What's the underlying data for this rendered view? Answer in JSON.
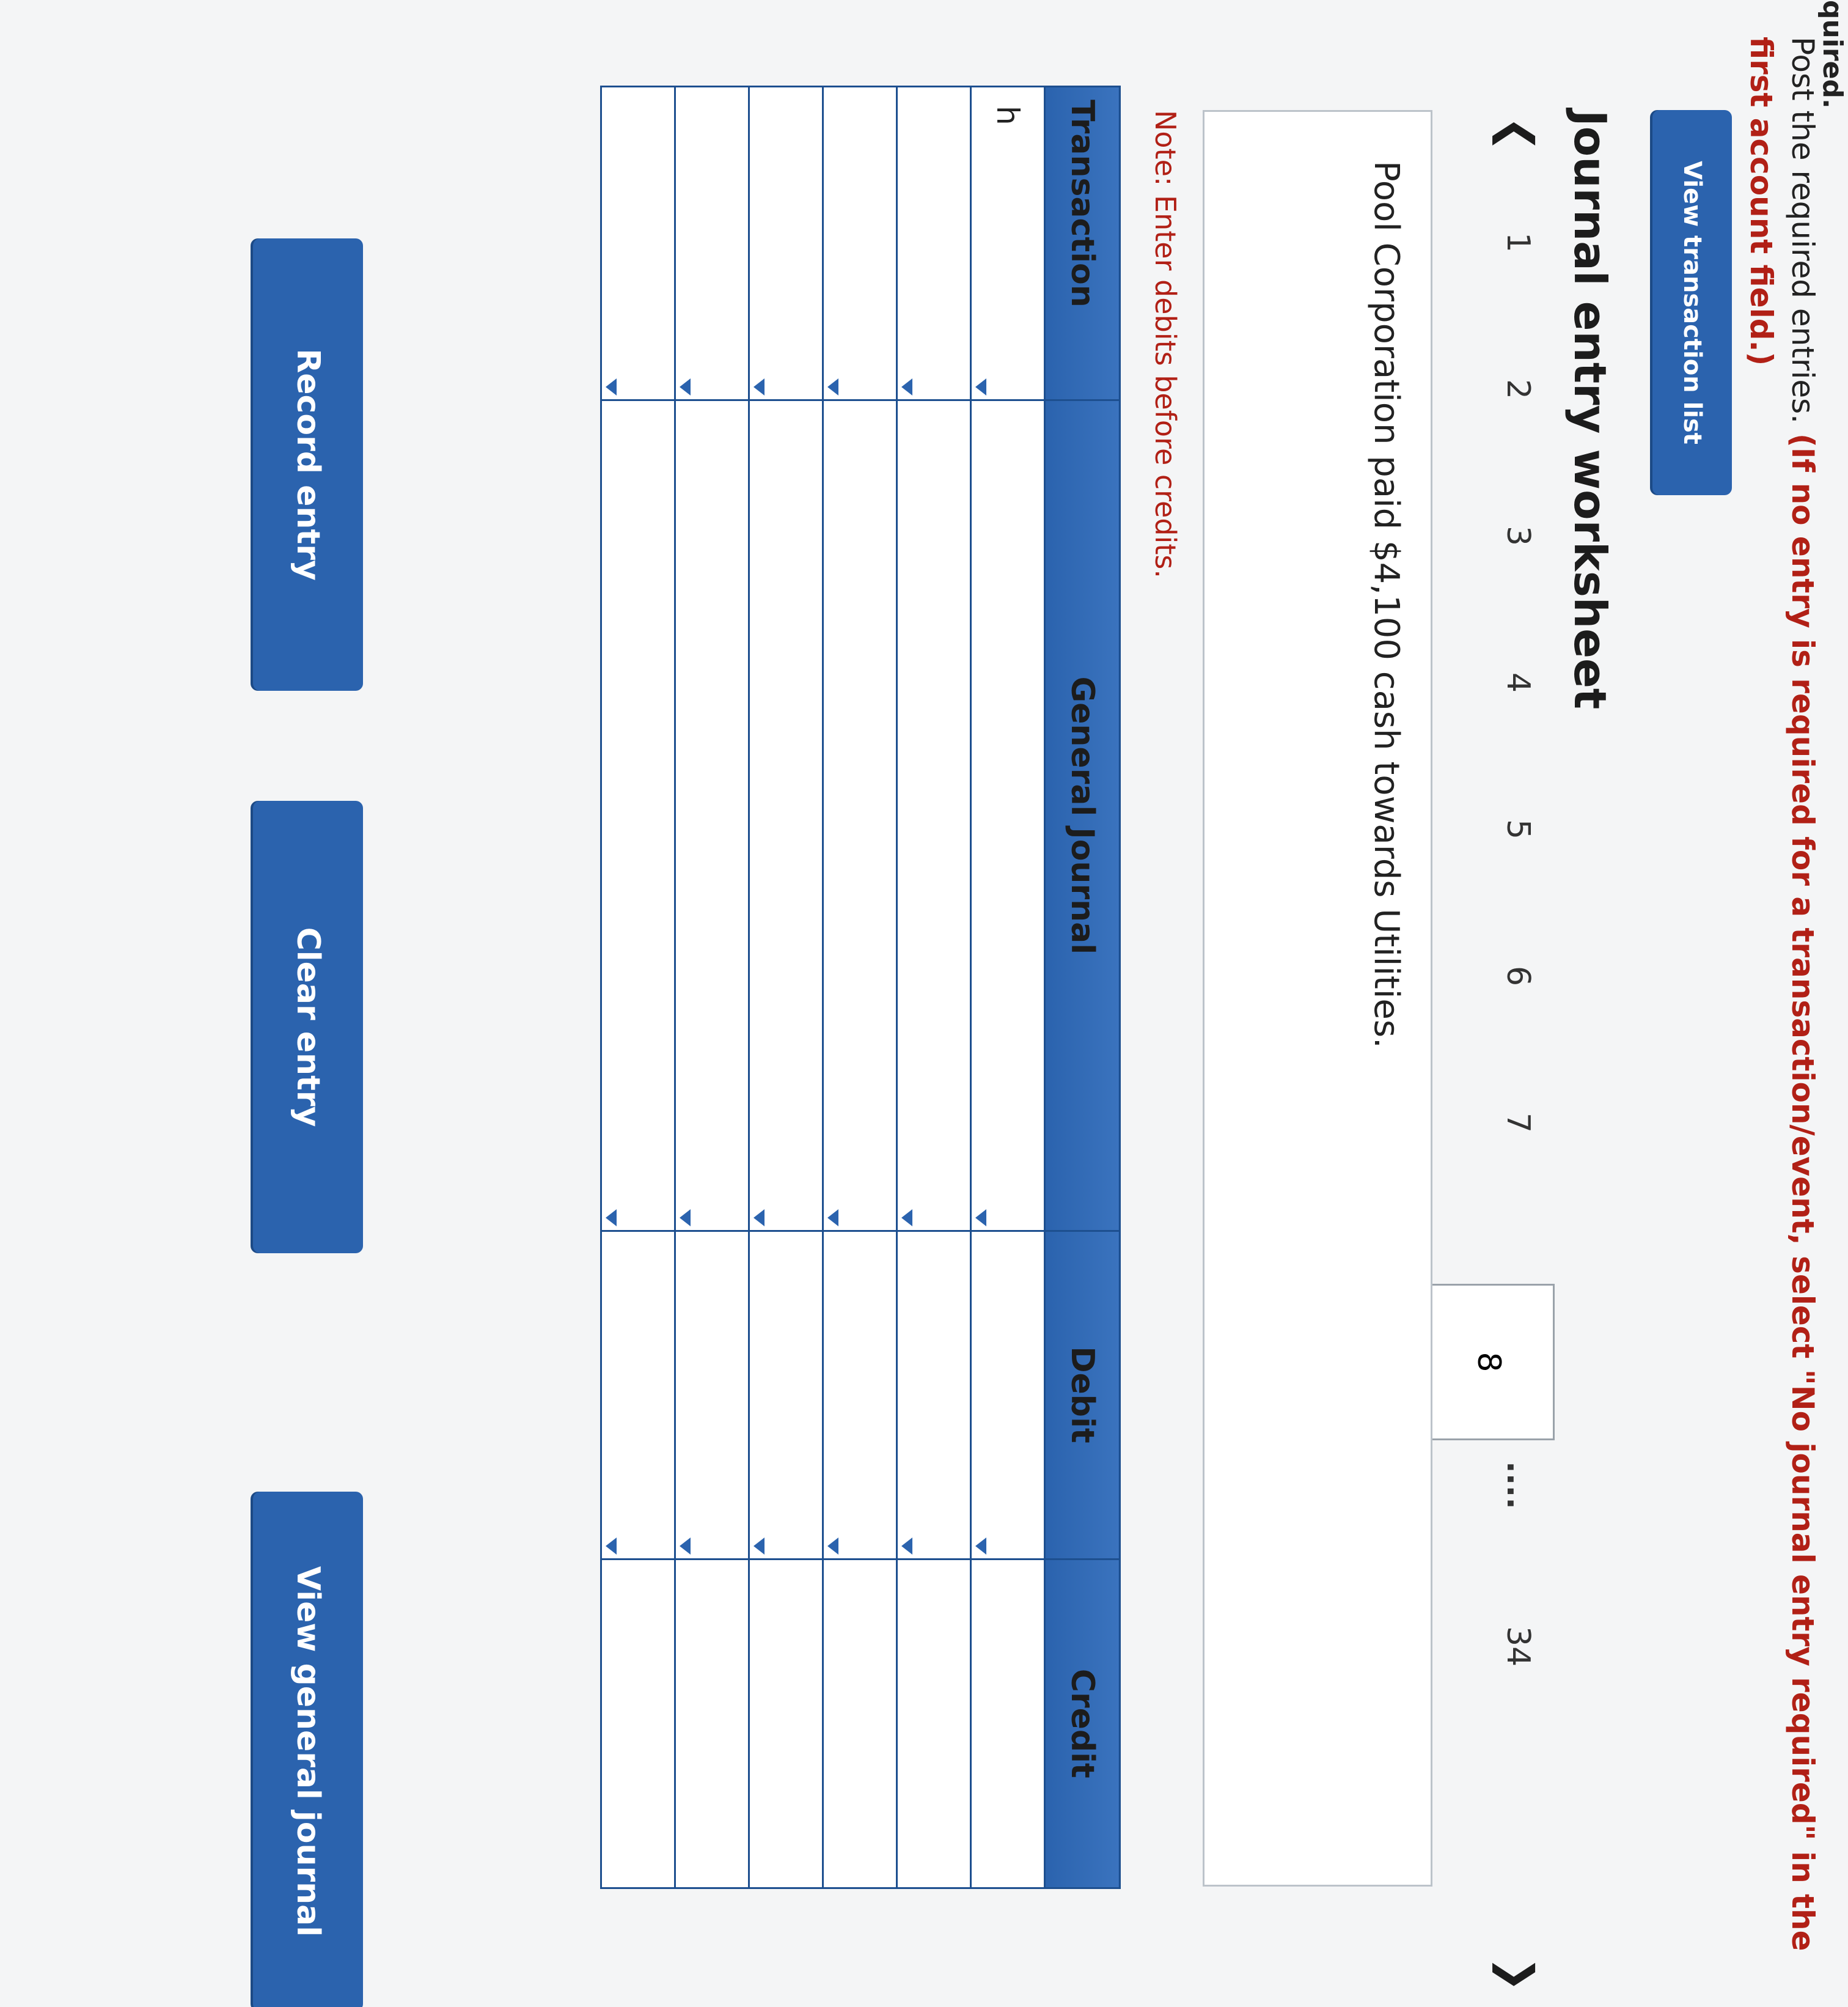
{
  "header": {
    "clipped_text": "quired.",
    "instruction_plain": "Post the required entries. ",
    "instruction_red": "(If no entry is required for a transaction/event, select \"No journal entry required\" in the first account field.)"
  },
  "buttons": {
    "view_transaction_list": "View transaction list",
    "record_entry": "Record entry",
    "clear_entry": "Clear entry",
    "view_general_journal": "View general journal"
  },
  "worksheet": {
    "title": "Journal entry worksheet",
    "prev_icon": "chevron-left-icon",
    "next_icon": "chevron-right-icon",
    "pages": [
      "1",
      "2",
      "3",
      "4",
      "5",
      "6",
      "7"
    ],
    "current_page": "8",
    "ellipsis": "....",
    "last_page": "34",
    "description": "Pool Corporation paid $4,100 cash towards Utilities.",
    "note": "Note: Enter debits before credits."
  },
  "journal": {
    "headers": {
      "transaction": "Transaction",
      "general_journal": "General Journal",
      "debit": "Debit",
      "credit": "Credit"
    },
    "rows": [
      {
        "transaction": "h",
        "account": "",
        "debit": "",
        "credit": ""
      },
      {
        "transaction": "",
        "account": "",
        "debit": "",
        "credit": ""
      },
      {
        "transaction": "",
        "account": "",
        "debit": "",
        "credit": ""
      },
      {
        "transaction": "",
        "account": "",
        "debit": "",
        "credit": ""
      },
      {
        "transaction": "",
        "account": "",
        "debit": "",
        "credit": ""
      },
      {
        "transaction": "",
        "account": "",
        "debit": "",
        "credit": ""
      }
    ]
  },
  "colors": {
    "accent": "#2b63ae",
    "warning_text": "#b12016"
  }
}
